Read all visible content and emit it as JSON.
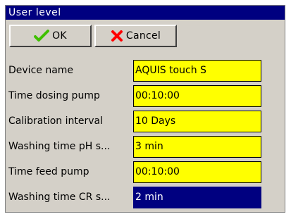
{
  "window": {
    "title": "User level"
  },
  "toolbar": {
    "ok_label": "OK",
    "cancel_label": "Cancel",
    "ok_icon": "checkmark-icon",
    "cancel_icon": "x-icon",
    "ok_icon_color": "#40c000",
    "cancel_icon_color": "#ff0000"
  },
  "colors": {
    "title_bar": "#000080",
    "panel": "#d4d0c8",
    "field_background": "#ffff00",
    "selected_field": "#000080"
  },
  "fields": [
    {
      "label": "Device name",
      "value": "AQUIS touch S",
      "selected": false
    },
    {
      "label": "Time dosing pump",
      "value": "00:10:00",
      "selected": false
    },
    {
      "label": "Calibration interval",
      "value": "10 Days",
      "selected": false
    },
    {
      "label": "Washing time pH s...",
      "value": "3 min",
      "selected": false
    },
    {
      "label": "Time feed pump",
      "value": "00:10:00",
      "selected": false
    },
    {
      "label": "Washing time CR s...",
      "value": "2 min",
      "selected": true
    }
  ]
}
